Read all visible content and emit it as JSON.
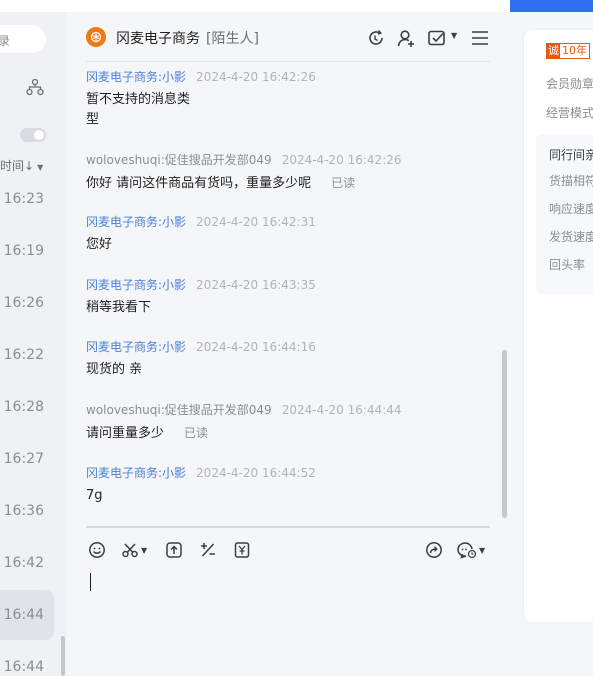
{
  "sessions": {
    "search_placeholder": "录",
    "sort_label": "时间↓",
    "times": [
      "16:23",
      "16:19",
      "16:26",
      "16:22",
      "16:28",
      "16:27",
      "16:36",
      "16:42",
      "16:44",
      "16:44"
    ]
  },
  "chat": {
    "shop_name": "冈麦电子商务",
    "shop_tag": "[陌生人]",
    "messages": [
      {
        "sender": "冈麦电子商务:小影",
        "time": "2024-4-20 16:42:26",
        "line1": "暂不支持的消息类",
        "line2": "型",
        "read": ""
      },
      {
        "sender": "woloveshuqi:促佳搜品开发部049",
        "time": "2024-4-20 16:42:26",
        "line1": "你好 请问这件商品有货吗，重量多少呢",
        "read": "已读"
      },
      {
        "sender": "冈麦电子商务:小影",
        "time": "2024-4-20 16:42:31",
        "line1": "您好",
        "read": ""
      },
      {
        "sender": "冈麦电子商务:小影",
        "time": "2024-4-20 16:43:35",
        "line1": "稍等我看下",
        "read": ""
      },
      {
        "sender": "冈麦电子商务:小影",
        "time": "2024-4-20 16:44:16",
        "line1": "现货的  亲",
        "read": ""
      },
      {
        "sender": "woloveshuqi:促佳搜品开发部049",
        "time": "2024-4-20 16:44:44",
        "line1": "请问重量多少",
        "read": "已读"
      },
      {
        "sender": "冈麦电子商务:小影",
        "time": "2024-4-20 16:44:52",
        "line1": "7g",
        "read": ""
      }
    ]
  },
  "right_panel": {
    "badge_a": "诚",
    "badge_b": "10年",
    "rows": [
      "会员勋章",
      "经营模式"
    ],
    "peer_title": "同行间亲",
    "peer_rows": [
      "货描相符",
      "响应速度",
      "发货速度",
      "回头率"
    ]
  },
  "colors": {
    "accent_blue": "#2f6ff0",
    "sender_blue": "#4a7fd8",
    "brand_orange": "#f07a12",
    "badge_orange": "#e8590c"
  },
  "icons": {
    "header": [
      "refresh-icon",
      "add-contact-icon",
      "task-check-icon",
      "menu-icon"
    ],
    "toolbar": [
      "emoji-icon",
      "scissors-icon",
      "upload-icon",
      "discount-icon",
      "price-tag-icon",
      "share-icon",
      "quick-reply-icon"
    ]
  }
}
